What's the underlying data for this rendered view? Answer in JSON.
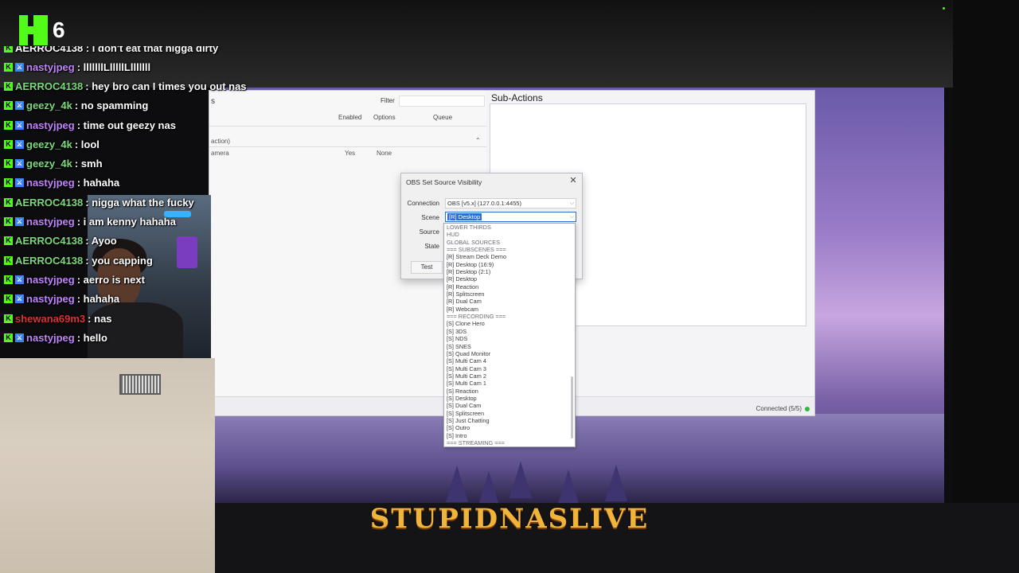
{
  "logo": {
    "viewer_count": "6",
    "accent": "#53fc18"
  },
  "chat": {
    "clipped_line": "AERROC4138 : i don't eat that nigga dirty",
    "messages": [
      {
        "user": "nastyjpeg",
        "user_color": "#c084fc",
        "text": "lllllllLlllllLlllllll"
      },
      {
        "user": "AERROC4138",
        "user_color": "#7dd87d",
        "text": "hey bro can I times you out nas"
      },
      {
        "user": "geezy_4k",
        "user_color": "#7dd87d",
        "text": "no spamming"
      },
      {
        "user": "nastyjpeg",
        "user_color": "#c084fc",
        "text": "time out geezy nas"
      },
      {
        "user": "geezy_4k",
        "user_color": "#7dd87d",
        "text": "lool"
      },
      {
        "user": "geezy_4k",
        "user_color": "#7dd87d",
        "text": "smh"
      },
      {
        "user": "nastyjpeg",
        "user_color": "#c084fc",
        "text": "hahaha"
      },
      {
        "user": "AERROC4138",
        "user_color": "#7dd87d",
        "text": "nigga what the fucky"
      },
      {
        "user": "nastyjpeg",
        "user_color": "#c084fc",
        "text": "i am kenny hahaha"
      },
      {
        "user": "AERROC4138",
        "user_color": "#7dd87d",
        "text": "Ayoo"
      },
      {
        "user": "AERROC4138",
        "user_color": "#7dd87d",
        "text": "you capping"
      },
      {
        "user": "nastyjpeg",
        "user_color": "#c084fc",
        "text": "aerro is next"
      },
      {
        "user": "nastyjpeg",
        "user_color": "#c084fc",
        "text": "hahaha"
      },
      {
        "user": "shewana69m3",
        "user_color": "#e03030",
        "text": "nas"
      },
      {
        "user": "nastyjpeg",
        "user_color": "#c084fc",
        "text": "hello"
      }
    ]
  },
  "obs": {
    "panel_title_fragment": "s",
    "filter_label": "Filter",
    "columns": {
      "enabled": "Enabled",
      "options": "Options",
      "queue": "Queue"
    },
    "group_row": "action)",
    "action_row": {
      "name": "amera",
      "enabled": "Yes",
      "queue": "None"
    },
    "subactions_title": "Sub-Actions",
    "status": "Connected (5/5)",
    "status_color": "#2dbb3c"
  },
  "dialog": {
    "title": "OBS Set Source Visibility",
    "close": "✕",
    "connection_label": "Connection",
    "connection_value": "OBS [v5.x] (127.0.0.1:4455)",
    "scene_label": "Scene",
    "scene_value": "[R] Desktop",
    "source_label": "Source",
    "state_label": "State",
    "test_label": "Test"
  },
  "dropdown": {
    "options": [
      "LOWER THIRDS",
      "HUD",
      "GLOBAL SOURCES",
      "=== SUBSCENES ===",
      "[R] Stream Deck Demo",
      "[R] Desktop (16:9)",
      "[R] Desktop (2:1)",
      "[R] Desktop",
      "[R] Reaction",
      "[R] Splitscreen",
      "[R] Dual Cam",
      "[R] Webcam",
      "=== RECORDING ===",
      "[S] Clone Hero",
      "[S] 3DS",
      "[S] NDS",
      "[S] SNES",
      "[S] Quad Monitor",
      "[S] Multi Cam 4",
      "[S] Multi Cam 3",
      "[S] Multi Cam 2",
      "[S] Multi Cam 1",
      "[S] Reaction",
      "[S] Desktop",
      "[S] Dual Cam",
      "[S] Splitscreen",
      "[S] Just Chatting",
      "[S] Outro",
      "[S] Intro",
      "=== STREAMING ==="
    ]
  },
  "banner": {
    "text": "STUPIDNASLIVE",
    "color": "#f0b43a"
  }
}
